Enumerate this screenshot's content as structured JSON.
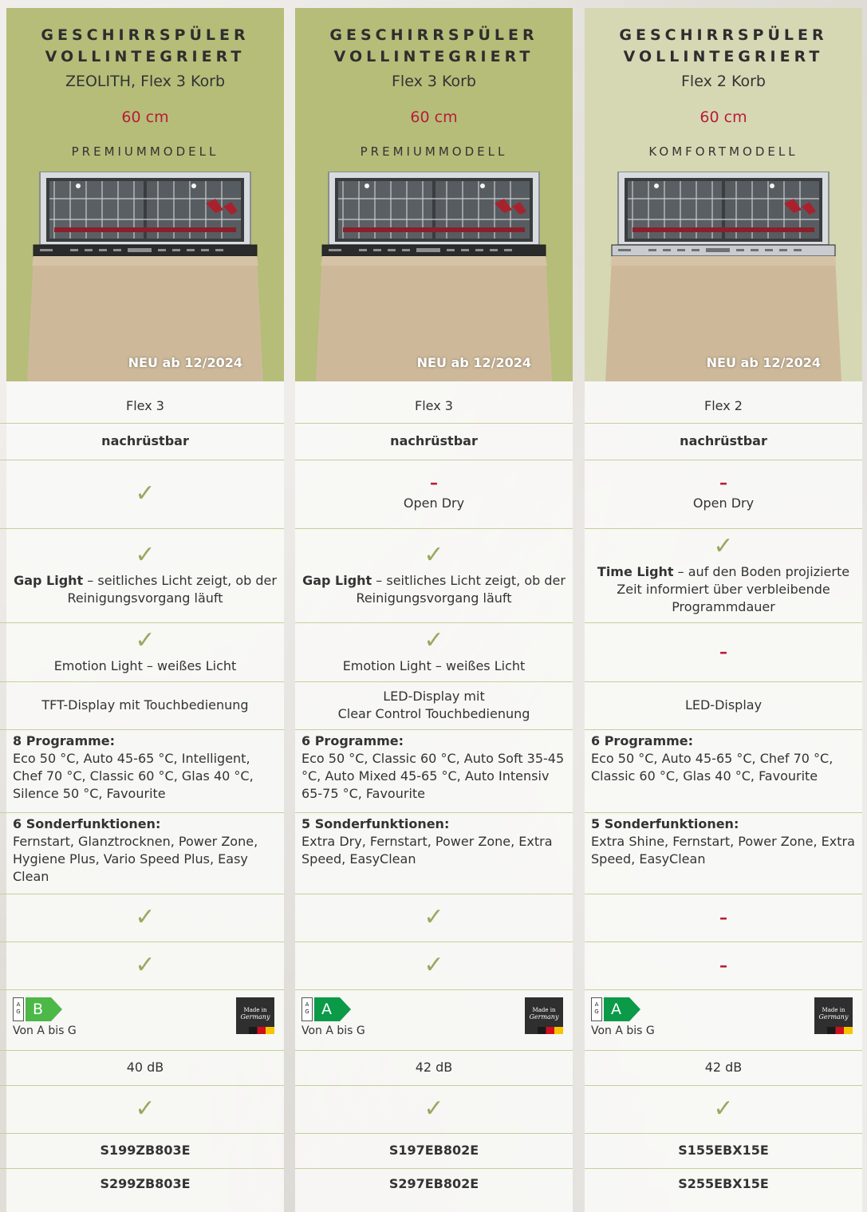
{
  "columns": [
    {
      "title_line1": "GESCHIRRSPÜLER",
      "title_line2": "VOLLINTEGRIERT",
      "subtitle": "ZEOLITH, Flex 3 Korb",
      "size": "60 cm",
      "model_class": "PREMIUMMODELL",
      "badge": "NEU ab 12/2024",
      "header_color": "#b5bd79",
      "panel": "dark",
      "basket": "Flex 3",
      "upgrade": "nachrüstbar",
      "drying": {
        "check": true,
        "dash": false,
        "text": ""
      },
      "light": {
        "check": true,
        "dash": false,
        "bold": "Gap Light",
        "text": " – seitliches Licht zeigt, ob der Reinigungsvorgang läuft"
      },
      "emotion_light": {
        "check": true,
        "dash": false,
        "text": "Emotion Light – weißes Licht"
      },
      "display_line1": "TFT-Display mit Touchbedienung",
      "display_line2": "",
      "programs_title": "8 Programme:",
      "programs_text": "Eco 50 °C, Auto 45-65 °C, Intelligent, Chef 70 °C, Classic 60 °C, Glas 40 °C, Silence 50 °C, Favourite",
      "functions_title": "6 Sonderfunktionen:",
      "functions_text": "Fernstart, Glanztrocknen, Power Zone, Hygiene Plus, Vario Speed Plus, Easy Clean",
      "feature_a": {
        "check": true,
        "dash": false
      },
      "feature_b": {
        "check": true,
        "dash": false
      },
      "energy_class": "B",
      "energy_color": "#4cb848",
      "energy_scale": "A G",
      "energy_note": "Von A bis G",
      "made_in_1": "Made in",
      "made_in_2": "Germany",
      "noise": "40 dB",
      "feature_c": {
        "check": true
      },
      "code_1": "S199ZB803E",
      "code_2": "S299ZB803E"
    },
    {
      "title_line1": "GESCHIRRSPÜLER",
      "title_line2": "VOLLINTEGRIERT",
      "subtitle": "Flex 3 Korb",
      "size": "60 cm",
      "model_class": "PREMIUMMODELL",
      "badge": "NEU ab 12/2024",
      "header_color": "#b5bd79",
      "panel": "dark",
      "basket": "Flex 3",
      "upgrade": "nachrüstbar",
      "drying": {
        "check": false,
        "dash": true,
        "text": "Open Dry"
      },
      "light": {
        "check": true,
        "dash": false,
        "bold": "Gap Light",
        "text": " – seitliches Licht zeigt, ob der Reinigungsvorgang läuft"
      },
      "emotion_light": {
        "check": true,
        "dash": false,
        "text": "Emotion Light – weißes Licht"
      },
      "display_line1": "LED-Display mit",
      "display_line2": "Clear Control Touchbedienung",
      "programs_title": "6 Programme:",
      "programs_text": "Eco 50 °C, Classic 60 °C, Auto Soft 35-45 °C, Auto Mixed 45-65 °C, Auto Intensiv 65-75 °C, Favourite",
      "functions_title": "5 Sonderfunktionen:",
      "functions_text": "Extra Dry, Fernstart, Power Zone, Extra Speed, EasyClean",
      "feature_a": {
        "check": true,
        "dash": false
      },
      "feature_b": {
        "check": true,
        "dash": false
      },
      "energy_class": "A",
      "energy_color": "#0a9a48",
      "energy_scale": "A G",
      "energy_note": "Von A bis G",
      "made_in_1": "Made in",
      "made_in_2": "Germany",
      "noise": "42 dB",
      "feature_c": {
        "check": true
      },
      "code_1": "S197EB802E",
      "code_2": "S297EB802E"
    },
    {
      "title_line1": "GESCHIRRSPÜLER",
      "title_line2": "VOLLINTEGRIERT",
      "subtitle": "Flex 2 Korb",
      "size": "60 cm",
      "model_class": "KOMFORTMODELL",
      "badge": "NEU ab 12/2024",
      "header_color": "#d6d8b4",
      "panel": "steel",
      "basket": "Flex 2",
      "upgrade": "nachrüstbar",
      "drying": {
        "check": false,
        "dash": true,
        "text": "Open Dry"
      },
      "light": {
        "check": true,
        "dash": false,
        "bold": "Time Light",
        "text": " – auf den Boden projizierte Zeit informiert über verbleibende Programmdauer"
      },
      "emotion_light": {
        "check": false,
        "dash": true,
        "text": ""
      },
      "display_line1": "LED-Display",
      "display_line2": "",
      "programs_title": "6 Programme:",
      "programs_text": "Eco 50 °C, Auto 45-65 °C, Chef 70 °C, Classic 60 °C, Glas 40 °C, Favourite",
      "functions_title": "5 Sonderfunktionen:",
      "functions_text": "Extra Shine, Fernstart, Power Zone, Extra Speed, EasyClean",
      "feature_a": {
        "check": false,
        "dash": true
      },
      "feature_b": {
        "check": false,
        "dash": true
      },
      "energy_class": "A",
      "energy_color": "#0a9a48",
      "energy_scale": "A G",
      "energy_note": "Von A bis G",
      "made_in_1": "Made in",
      "made_in_2": "Germany",
      "noise": "42 dB",
      "feature_c": {
        "check": true
      },
      "code_1": "S155EBX15E",
      "code_2": "S255EBX15E"
    }
  ],
  "symbols": {
    "check": "✓",
    "dash": "–"
  }
}
